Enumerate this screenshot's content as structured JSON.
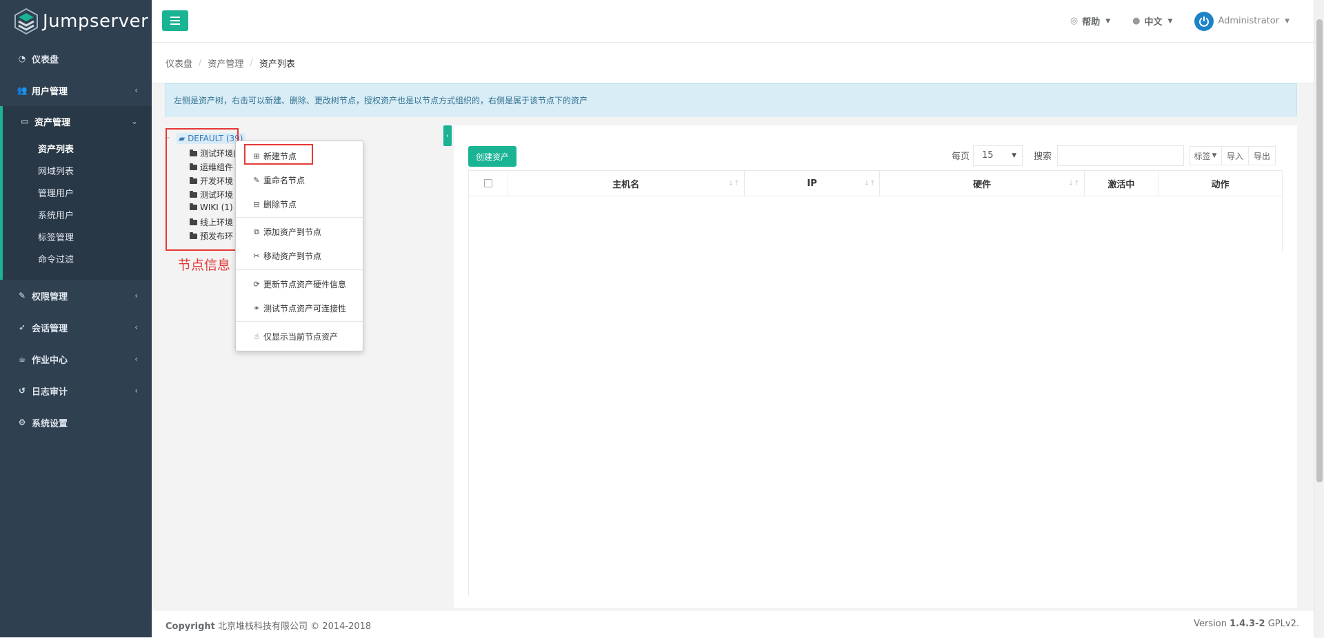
{
  "app": {
    "logo_text": "Jumpserver"
  },
  "sidebar": {
    "items": [
      {
        "label": "仪表盘",
        "icon": "dashboard-icon"
      },
      {
        "label": "用户管理",
        "icon": "users-icon"
      },
      {
        "label": "资产管理",
        "icon": "inbox-icon"
      },
      {
        "label": "权限管理",
        "icon": "edit-icon"
      },
      {
        "label": "会话管理",
        "icon": "rocket-icon"
      },
      {
        "label": "作业中心",
        "icon": "coffee-icon"
      },
      {
        "label": "日志审计",
        "icon": "history-icon"
      },
      {
        "label": "系统设置",
        "icon": "gears-icon"
      }
    ],
    "asset_submenu": [
      "资产列表",
      "网域列表",
      "管理用户",
      "系统用户",
      "标签管理",
      "命令过滤"
    ]
  },
  "topbar": {
    "help": "帮助",
    "language": "中文",
    "user": "Administrator"
  },
  "breadcrumb": [
    "仪表盘",
    "资产管理",
    "资产列表"
  ],
  "alert": "左侧是资产树，右击可以新建、删除、更改树节点，授权资产也是以节点方式组织的，右侧是属于该节点下的资产",
  "tree": {
    "root": "DEFAULT (39)",
    "nodes": [
      "测试环境(",
      "运维组件",
      "开发环境",
      "测试环境",
      "WIKI (1)",
      "线上环境",
      "预发布环"
    ],
    "annotation": "节点信息"
  },
  "context_menu": {
    "items": [
      "新建节点",
      "重命名节点",
      "删除节点",
      "添加资产到节点",
      "移动资产到节点",
      "更新节点资产硬件信息",
      "测试节点资产可连接性",
      "仅显示当前节点资产"
    ]
  },
  "table": {
    "create_button": "创建资产",
    "per_page_label": "每页",
    "per_page_value": "15",
    "search_label": "搜索",
    "search_value": "",
    "tag_button": "标签",
    "import_button": "导入",
    "export_button": "导出",
    "columns": [
      "主机名",
      "IP",
      "硬件",
      "激活中",
      "动作"
    ]
  },
  "footer": {
    "copyright_bold": "Copyright",
    "copyright_text": "北京堆栈科技有限公司 © 2014-2018",
    "version_label": "Version",
    "version_number": "1.4.3-2",
    "license": "GPLv2."
  },
  "colors": {
    "sidebar_bg": "#2f4050",
    "accent": "#1ab394",
    "annotation_red": "#e53935"
  }
}
